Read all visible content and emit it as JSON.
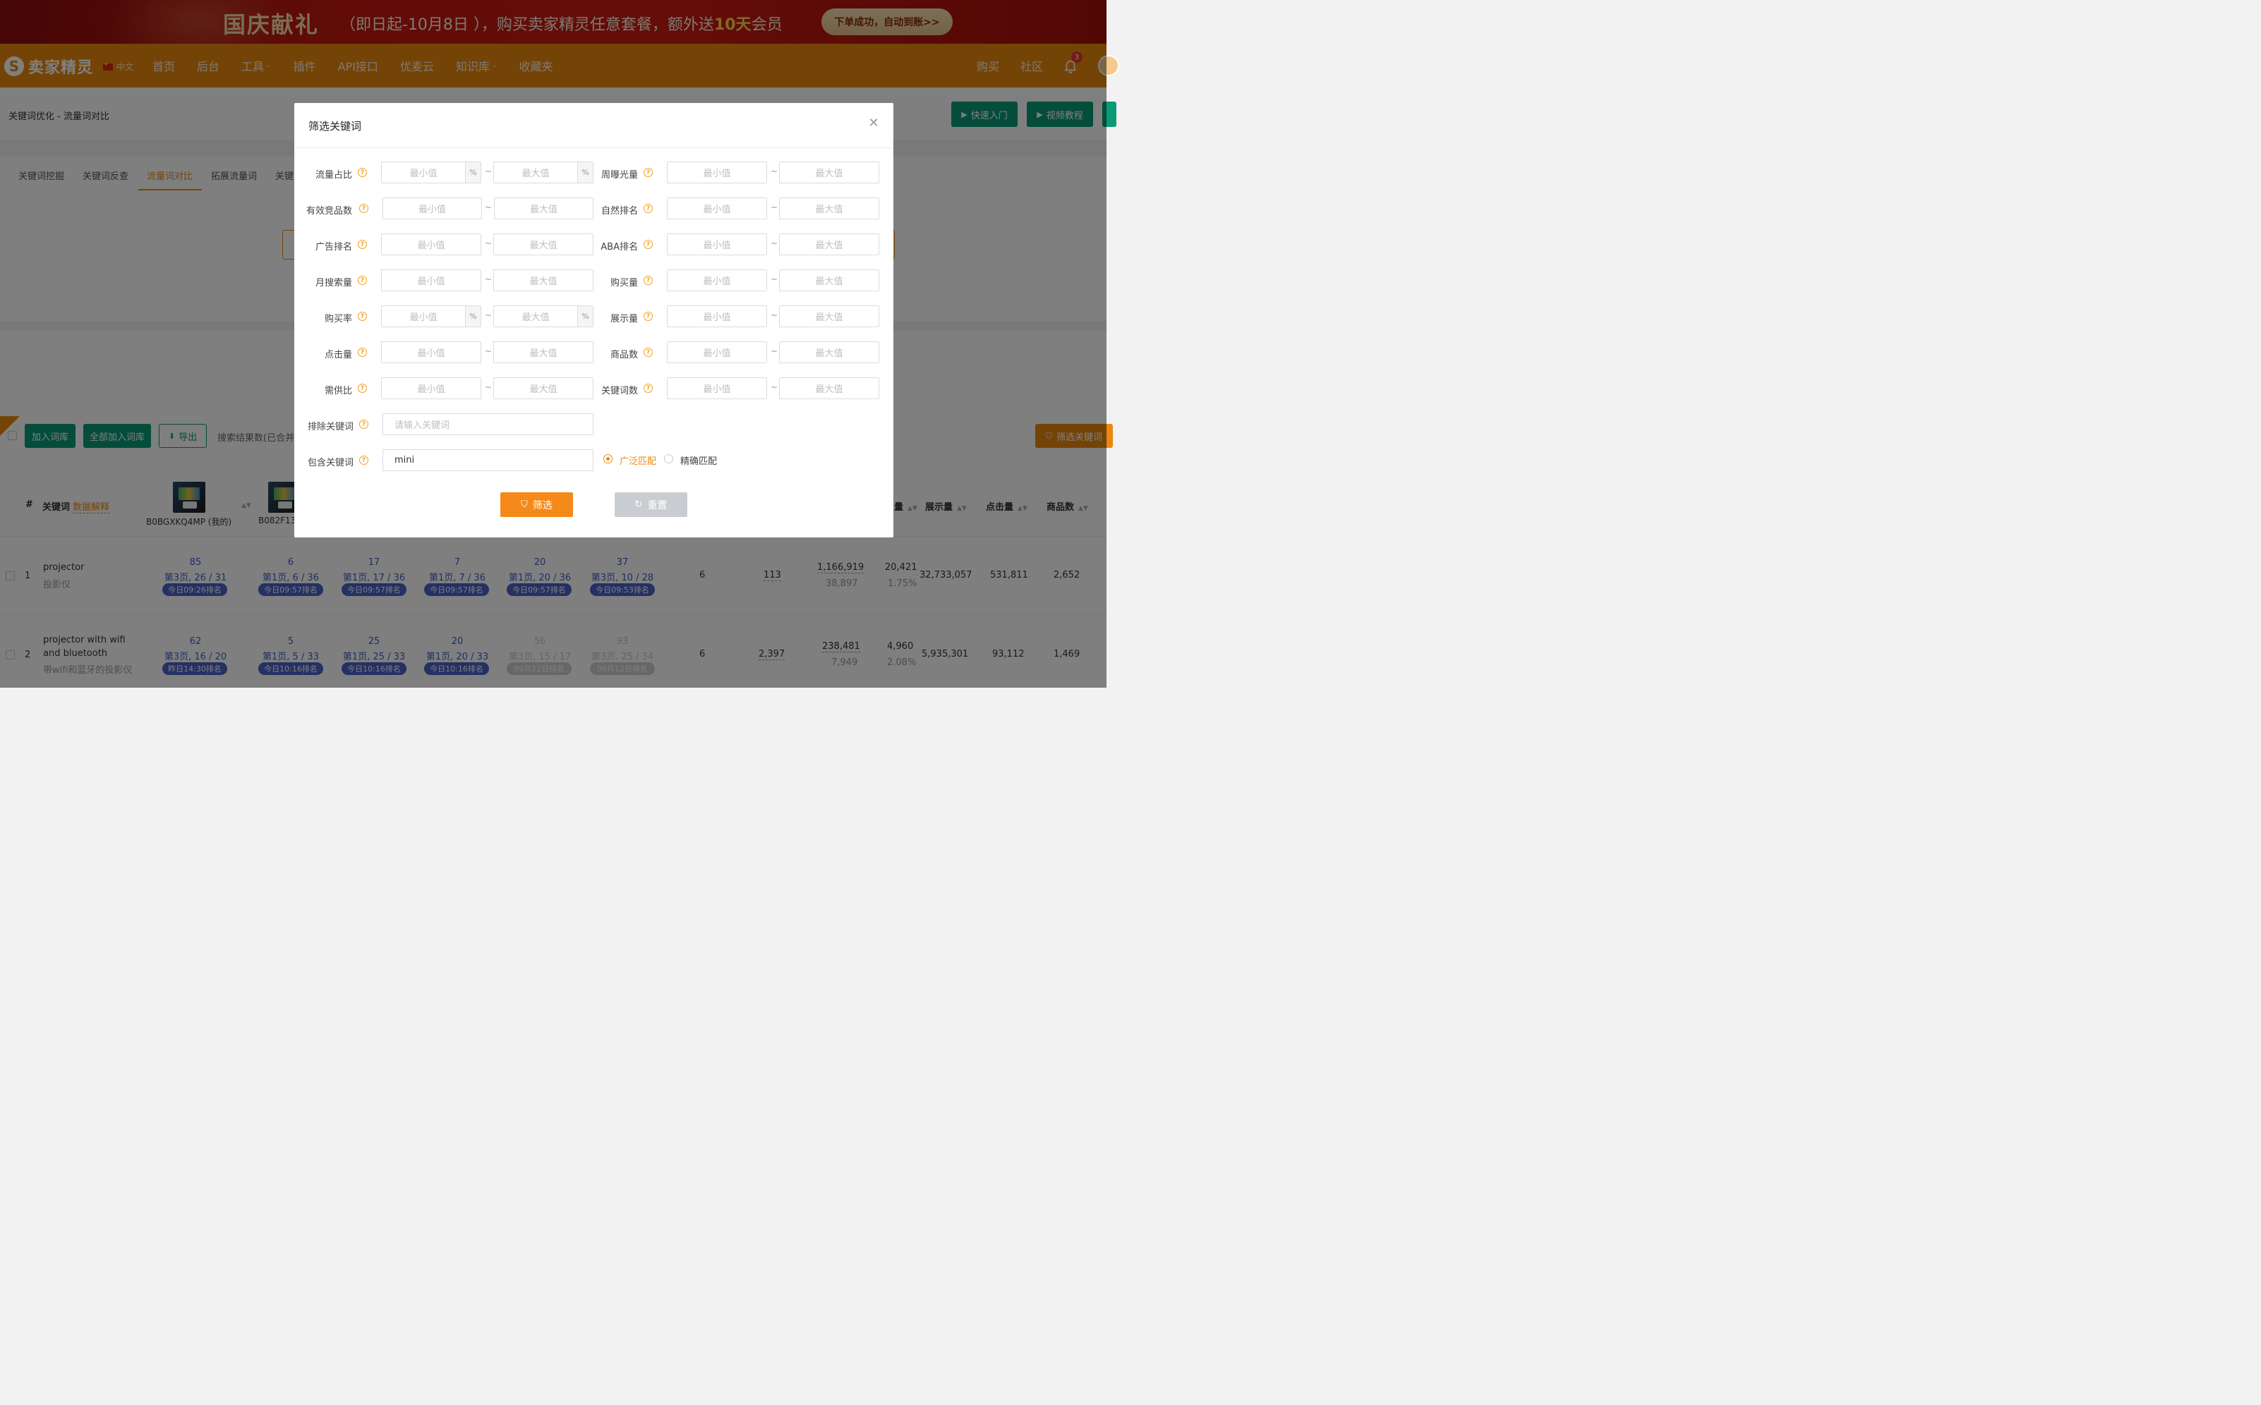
{
  "banner": {
    "title": "国庆献礼",
    "promo_pre": "（即日起-10月8日 ），购买卖家精灵任意套餐，额外送",
    "promo_hl": "10天",
    "promo_post": "会员",
    "cta": "下单成功，自动到账>>"
  },
  "nav": {
    "logo_text": "卖家精灵",
    "lang": "中文",
    "items": [
      "首页",
      "后台",
      "工具",
      "插件",
      "API接口",
      "优麦云",
      "知识库",
      "收藏夹"
    ],
    "right_items": [
      "购买",
      "社区"
    ],
    "notification_count": "3"
  },
  "page": {
    "breadcrumb": "关键词优化 - 流量词对比",
    "quick_start": "快速入门",
    "video_tutorial": "视频教程",
    "tabs": [
      "关键词挖掘",
      "关键词反查",
      "流量词对比",
      "拓展流量词",
      "关键"
    ],
    "add_to_lib": "加入词库",
    "add_all_to_lib": "全部加入词库",
    "export": "导出",
    "result_count": "搜索结果数(已合并",
    "filter_keywords": "筛选关键词"
  },
  "table": {
    "headers": {
      "index": "#",
      "keyword": "关键词",
      "keyword_link": "数据解释",
      "prod1": "B0BGXKQ4MP (我的)",
      "prod2": "B082F13",
      "col_qty": "量",
      "col_impr": "展示量",
      "col_clicks": "点击量",
      "col_products": "商品数"
    },
    "rows": [
      {
        "idx": "1",
        "kw": "projector",
        "kw_cn": "投影仪",
        "ranks": [
          {
            "num": "85",
            "page": "第3页, 26 / 31",
            "tag": "今日09:26排名",
            "dim": false
          },
          {
            "num": "6",
            "page": "第1页, 6 / 36",
            "tag": "今日09:57排名",
            "dim": false
          },
          {
            "num": "17",
            "page": "第1页, 17 / 36",
            "tag": "今日09:57排名",
            "dim": false
          },
          {
            "num": "7",
            "page": "第1页, 7 / 36",
            "tag": "今日09:57排名",
            "dim": false
          },
          {
            "num": "20",
            "page": "第1页, 20 / 36",
            "tag": "今日09:57排名",
            "dim": false
          },
          {
            "num": "37",
            "page": "第3页, 10 / 28",
            "tag": "今日09:53排名",
            "dim": false
          }
        ],
        "c1": "6",
        "c2": "113",
        "c3": "1,166,919",
        "c3b": "38,897",
        "c4": "20,421",
        "c4b": "1.75%",
        "c5": "32,733,057",
        "c6": "531,811",
        "c7": "2,652"
      },
      {
        "idx": "2",
        "kw": "projector with wifi",
        "kw2": "and bluetooth",
        "kw_cn": "带wifi和蓝牙的投影仪",
        "ranks": [
          {
            "num": "62",
            "page": "第3页, 16 / 20",
            "tag": "昨日14:30排名",
            "dim": false
          },
          {
            "num": "5",
            "page": "第1页, 5 / 33",
            "tag": "今日10:16排名",
            "dim": false
          },
          {
            "num": "25",
            "page": "第1页, 25 / 33",
            "tag": "今日10:16排名",
            "dim": false
          },
          {
            "num": "20",
            "page": "第1页, 20 / 33",
            "tag": "今日10:16排名",
            "dim": false
          },
          {
            "num": "56",
            "page": "第3页, 15 / 17",
            "tag": "09月22日排名",
            "dim": true
          },
          {
            "num": "93",
            "page": "第3页, 25 / 34",
            "tag": "09月12日排名",
            "dim": true
          }
        ],
        "c1": "6",
        "c2": "2,397",
        "c3": "238,481",
        "c3b": "7,949",
        "c4": "4,960",
        "c4b": "2.08%",
        "c5": "5,935,301",
        "c6": "93,112",
        "c7": "1,469"
      }
    ]
  },
  "modal": {
    "title": "筛选关键词",
    "min_ph": "最小值",
    "max_ph": "最大值",
    "pct": "%",
    "tilde": "~",
    "left_fields": [
      "流量占比",
      "有效竞品数",
      "广告排名",
      "月搜索量",
      "购买率",
      "点击量",
      "需供比"
    ],
    "right_fields": [
      "周曝光量",
      "自然排名",
      "ABA排名",
      "购买量",
      "展示量",
      "商品数",
      "关键词数"
    ],
    "exclude_label": "排除关键词",
    "exclude_ph": "请输入关键词",
    "include_label": "包含关键词",
    "include_value": "mini",
    "match_broad": "广泛匹配",
    "match_exact": "精确匹配",
    "match_selected": "broad",
    "filter_btn": "筛选",
    "reset_btn": "重置"
  },
  "colors": {
    "brand_orange": "#e8890f",
    "green": "#0a9b76",
    "rank_blue": "#4b60c7",
    "banner_red": "#c2180f"
  }
}
